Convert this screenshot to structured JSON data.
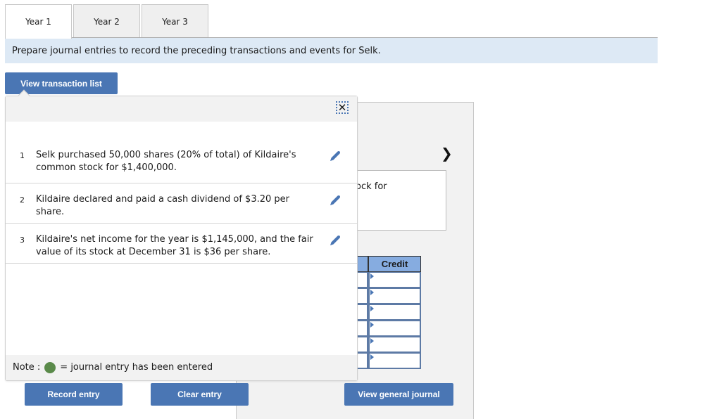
{
  "tabs": [
    {
      "label": "Year 1",
      "active": true
    },
    {
      "label": "Year 2",
      "active": false
    },
    {
      "label": "Year 3",
      "active": false
    }
  ],
  "instruction": "Prepare journal entries to record the preceding transactions and events for Selk.",
  "buttons": {
    "view_transaction_list": "View transaction list",
    "record_entry": "Record entry",
    "clear_entry": "Clear entry",
    "view_general_journal": "View general journal"
  },
  "popup": {
    "close_icon": "close-icon",
    "transactions": [
      {
        "number": "1",
        "text": "Selk purchased 50,000 shares (20% of total) of Kildaire's common stock for $1,400,000.",
        "icon": "pencil-icon"
      },
      {
        "number": "2",
        "text": "Kildaire declared and paid a cash dividend of $3.20 per share.",
        "icon": "pencil-icon"
      },
      {
        "number": "3",
        "text": "Kildaire's net income for the year is $1,145,000, and the fair value of its stock at December 31 is $36 per share.",
        "icon": "pencil-icon"
      }
    ],
    "note_prefix": "Note :",
    "note_suffix": "= journal entry has been entered",
    "note_dot_color": "#5a8a4a"
  },
  "entry_panel": {
    "next_icon": "chevron-right-icon",
    "description_fragment": "ock for",
    "credit_header": "Credit",
    "row_count": 6
  },
  "colors": {
    "button": "#4a76b4",
    "instruction_bg": "#dde9f5",
    "table_header": "#86ace0"
  }
}
